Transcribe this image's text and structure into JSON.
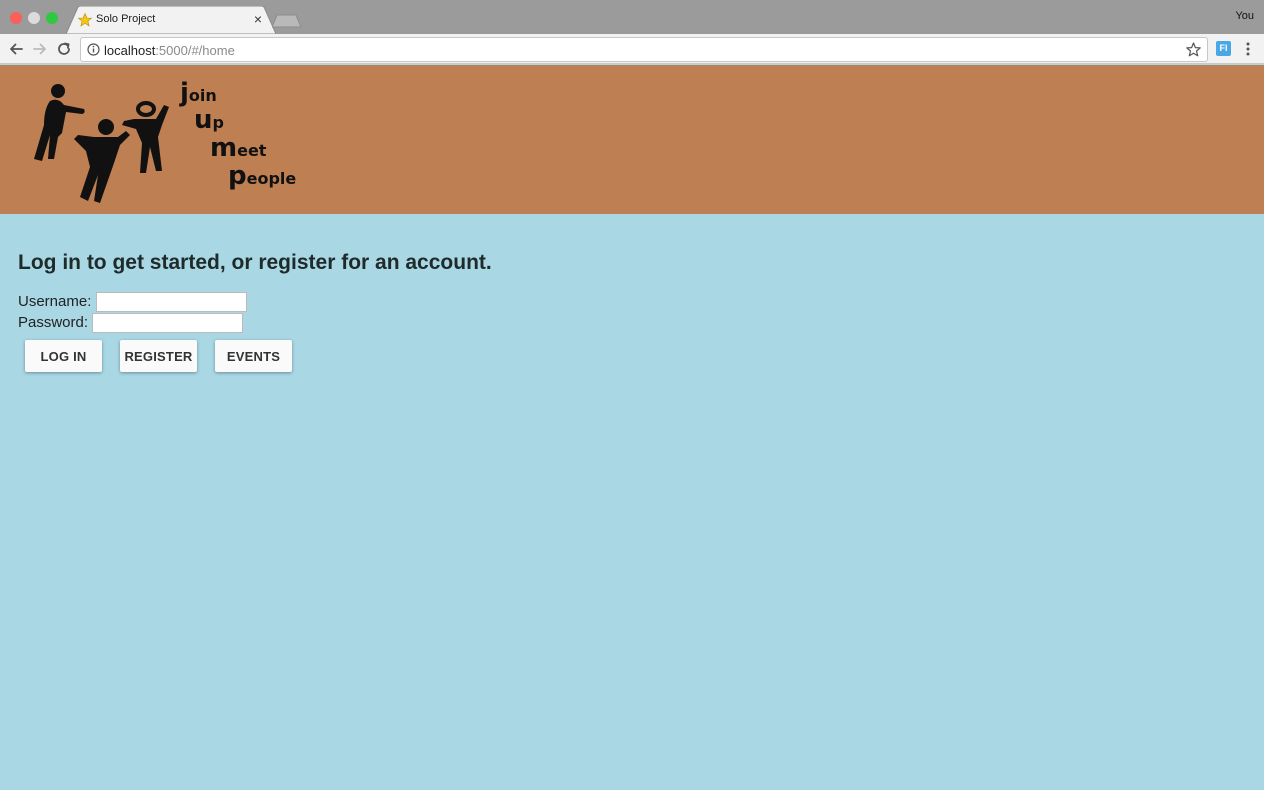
{
  "browser": {
    "tab_title": "Solo Project",
    "tab_close": "×",
    "profile_name": "You",
    "url_host": "localhost",
    "url_rest": ":5000/#/home",
    "extension_label": "Fl"
  },
  "banner": {
    "background_color": "#be7f52",
    "logo_words": [
      {
        "big": "j",
        "small": "oin"
      },
      {
        "big": "u",
        "small": "p"
      },
      {
        "big": "m",
        "small": "eet"
      },
      {
        "big": "p",
        "small": "eople"
      }
    ]
  },
  "login": {
    "heading": "Log in to get started, or register for an account.",
    "username_label": "Username:",
    "username_value": "",
    "password_label": "Password:",
    "password_value": ""
  },
  "buttons": {
    "login": "LOG IN",
    "register": "REGISTER",
    "events": "EVENTS"
  },
  "colors": {
    "page_background": "#a9d7e4",
    "banner": "#be7f52"
  }
}
